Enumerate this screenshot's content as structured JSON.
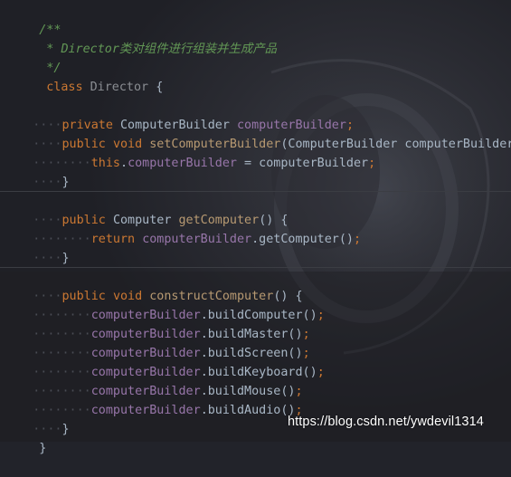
{
  "editor": {
    "theme": {
      "background": "#22232a",
      "comment": "#629755",
      "keyword": "#cc7832",
      "field": "#9876aa",
      "method": "#ffc66d",
      "text": "#a9b7c6"
    },
    "lines": {
      "l1": "/**",
      "l2_star": " * ",
      "l2_text": "Director类对组件进行组装并生成产品",
      "l3": " */",
      "l4_kw": "class",
      "l4_name": "Director",
      "l4_brace": "{",
      "l6_mod": "private",
      "l6_type": "ComputerBuilder",
      "l6_field": "computerBuilder",
      "l7_mod": "public",
      "l7_ret": "void",
      "l7_name": "setComputerBuilder",
      "l7_param": "(ComputerBuilder computerBuilder) {",
      "l8_this": "this",
      "l8_field": "computerBuilder",
      "l8_rest": " = computerBuilder",
      "l9": "}",
      "l11_mod": "public",
      "l11_type": "Computer",
      "l11_name": "getComputer",
      "l11_rest": "() {",
      "l12_ret": "return",
      "l12_field": "computerBuilder",
      "l12_rest": ".getComputer()",
      "l13": "}",
      "l15_mod": "public",
      "l15_ret": "void",
      "l15_name": "constructComputer",
      "l15_rest": "() {",
      "calls": [
        ".buildComputer()",
        ".buildMaster()",
        ".buildScreen()",
        ".buildKeyboard()",
        ".buildMouse()",
        ".buildAudio()"
      ],
      "calls_field": "computerBuilder",
      "l22": "}",
      "l23": "}",
      "semi": ";"
    },
    "whitespace_marker": "····"
  },
  "watermark": {
    "text": "https://blog.csdn.net/ywdevil1314"
  }
}
